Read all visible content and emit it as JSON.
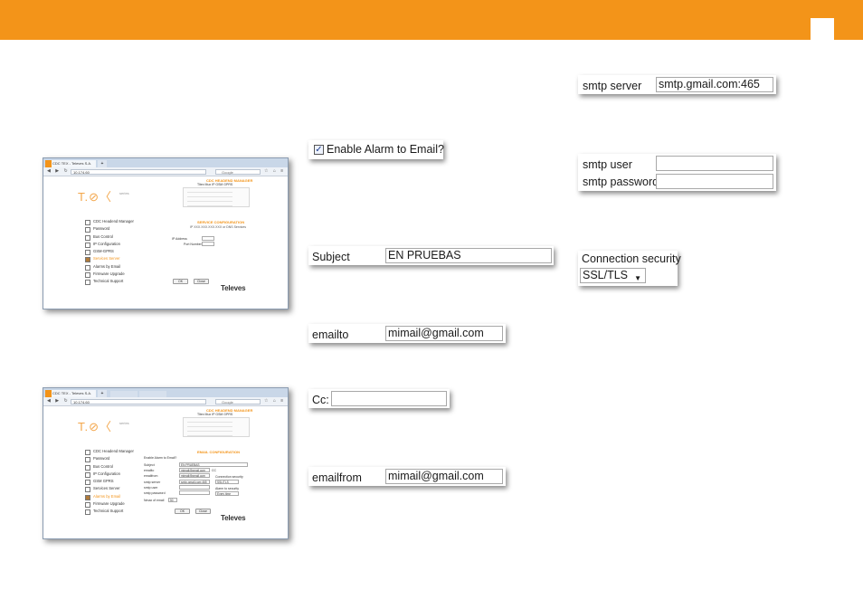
{
  "header": {
    "page_number": ""
  },
  "snippets": {
    "enable": {
      "label": "Enable Alarm to Email?",
      "checked": true
    },
    "subject": {
      "label": "Subject",
      "value": "EN PRUEBAS"
    },
    "emailto": {
      "label": "emailto",
      "value": "mimail@gmail.com"
    },
    "cc": {
      "label": "Cc:",
      "value": ""
    },
    "emailfrom": {
      "label": "emailfrom",
      "value": "mimail@gmail.com"
    },
    "smtp_server": {
      "label": "smtp server",
      "value": "smtp.gmail.com:465"
    },
    "smtp_user": {
      "label": "smtp user",
      "value": ""
    },
    "smtp_password": {
      "label": "smtp password",
      "value": ""
    },
    "connection_security": {
      "label": "Connection security",
      "value": "SSL/TLS"
    }
  },
  "browser1": {
    "tab": "CDC TEX - Televes S.A.",
    "url": "10.174.60",
    "search": "Google",
    "logo": "T.",
    "logo_sub": "series",
    "head_title": "CDC HEADEND MANAGER",
    "head_sub": "Tltex Mux IP GSM GPRS",
    "menu": [
      "CDC Headend Manager",
      "Password",
      "Bus Control",
      "IP Configuration",
      "GSM-GPRS",
      "Services Server",
      "Alarms by Email",
      "Firmware Upgrade",
      "Technical Support"
    ],
    "active_index": 5,
    "section_title": "SERVICE CONFIGURATION",
    "section_sub": "IP XXX.XXX.XXX.XXX or DNS Services",
    "fields": [
      "IP Address",
      "Port Number"
    ],
    "ok": "OK",
    "close": "Close",
    "brand": "Televes"
  },
  "browser2": {
    "tab": "CDC TEX - Televes S.A.",
    "url": "10.174.60",
    "search": "Google",
    "logo": "T.",
    "logo_sub": "series",
    "head_title": "CDC HEADEND MANAGER",
    "head_sub": "Tltex Mux IP GSM GPRS",
    "menu": [
      "CDC Headend Manager",
      "Password",
      "Bus Control",
      "IP Configuration",
      "GSM GPRS",
      "Services Server",
      "Alarms by Email",
      "Firmware Upgrade",
      "Technical Support"
    ],
    "active_index": 6,
    "section_title": "EMAIL CONFIGURATION",
    "enable": "Enable Alarm to Email?",
    "rows": [
      {
        "label": "Subject",
        "value": "EN PRUEBAS"
      },
      {
        "label": "emailto",
        "value": "mimail@gmail.com"
      },
      {
        "label": "emailfrom",
        "value": "mimail@gmail.com"
      },
      {
        "label": "smtp server",
        "value": "smtp.gmail.com:465"
      },
      {
        "label": "smtp user",
        "value": ""
      },
      {
        "label": "smtp password",
        "value": ""
      },
      {
        "label": "Nmax of email",
        "value": "50"
      }
    ],
    "cc": "CC",
    "conn_label": "Connection security",
    "conn_value": "SSL/TLS",
    "alarm_label": "Alarm to security",
    "alarm_value": "Every time",
    "ok": "OK",
    "close": "Close",
    "brand": "Televes"
  },
  "colors": {
    "accent": "#f39419"
  }
}
